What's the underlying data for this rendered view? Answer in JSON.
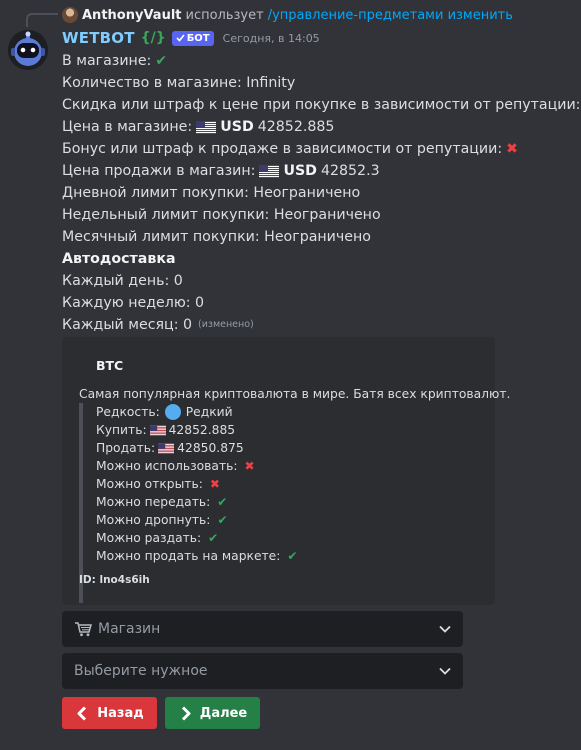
{
  "reply": {
    "username": "AnthonyVault",
    "verb": "использует",
    "command": "/управление-предметами изменить"
  },
  "header": {
    "bot_name": "WETBOT",
    "slash_text": "{/}",
    "bot_tag": "БОТ",
    "timestamp": "Сегодня, в 14:05"
  },
  "message": {
    "in_shop_label": "В магазине:",
    "quantity": "Количество в магазине: Infinity",
    "buy_rep_label": "Скидка или штраф к цене при покупке в зависимости от репутации:",
    "shop_price_label": "Цена в магазине:",
    "shop_price_currency": "USD",
    "shop_price_value": "42852.885",
    "sell_rep_label": "Бонус или штраф к продаже в зависимости от репутации:",
    "sell_price_label": "Цена продажи в магазин:",
    "sell_price_currency": "USD",
    "sell_price_value": "42852.3",
    "daily_limit": "Дневной лимит покупки: Неограничено",
    "weekly_limit": "Недельный лимит покупки: Неограничено",
    "monthly_limit": "Месячный лимит покупки: Неограничено",
    "autodelivery_title": "Автодоставка",
    "every_day": "Каждый день: 0",
    "every_week": "Каждую неделю: 0",
    "every_month": "Каждый месяц: 0",
    "edited": "(изменено)"
  },
  "embed": {
    "title": "BTC",
    "description": "Самая популярная криптовалюта в мире. Батя всех криптовалют.",
    "rarity_label": "Редкость:",
    "rarity_value": "Редкий",
    "buy_label": "Купить:",
    "buy_value": "42852.885",
    "sell_label": "Продать:",
    "sell_value": "42850.875",
    "can_use": "Можно использовать:",
    "can_open": "Можно открыть:",
    "can_transfer": "Можно передать:",
    "can_drop": "Можно дропнуть:",
    "can_give": "Можно раздать:",
    "can_sell_market": "Можно продать на маркете:",
    "id": "ID: lno4s6ih"
  },
  "selects": {
    "shop": "Магазин",
    "choose": "Выберите нужное"
  },
  "buttons": {
    "back": "Назад",
    "next": "Далее"
  },
  "colors": {
    "background": "#313338",
    "embed_bg": "#2b2d31",
    "bot_name": "#80ccff",
    "command_link": "#00a8fc",
    "check": "#3ba55d",
    "cross": "#f23f43",
    "back_button": "#da373c",
    "next_button": "#248046",
    "bot_tag": "#5865f2"
  },
  "icons": {
    "check": "check-mark-icon",
    "cross": "cross-mark-icon",
    "flag": "us-flag-icon",
    "rarity": "blue-circle-icon",
    "cart": "shopping-cart-icon",
    "chevron": "chevron-down-icon",
    "back": "arrow-left-icon",
    "next": "arrow-right-icon"
  }
}
